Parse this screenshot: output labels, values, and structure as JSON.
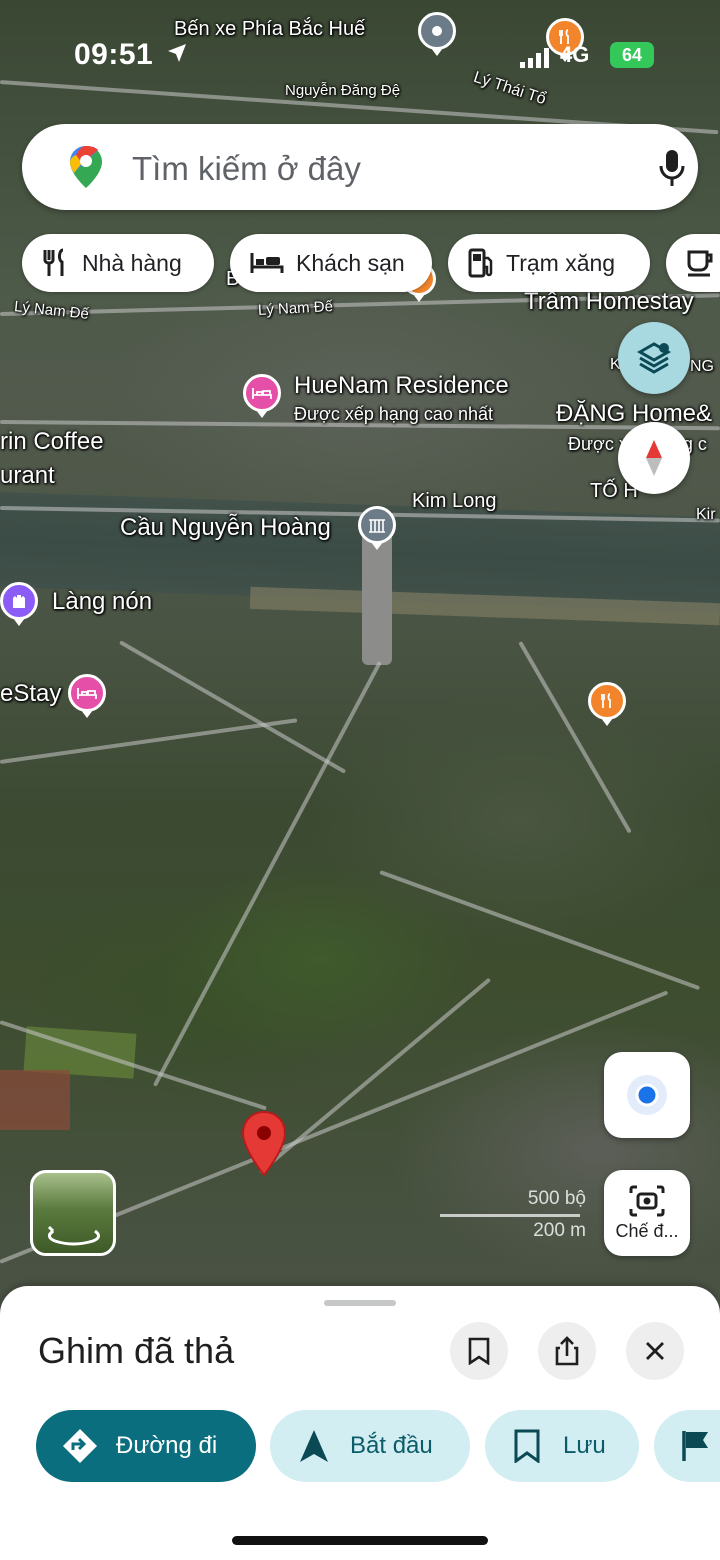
{
  "status_bar": {
    "time": "09:51",
    "network": "4G",
    "battery": "64"
  },
  "map": {
    "labels": {
      "bus_station": "Bến xe Phía Bắc Huế",
      "street_nguyen_dang_de": "Nguyễn Đăng Đệ",
      "street_ly_thai_to": "Lý Thái Tổ",
      "street_ly_nam_de_1": "Lý Nam Đế",
      "street_ly_nam_de_2": "Lý Nam Đế",
      "tram_homestay": "Trâm Homestay",
      "huenam_name": "HueNam Residence",
      "huenam_sub": "Được xếp hạng cao nhất",
      "dang_home": "ĐẶNG Home&",
      "dang_home_sub": "Được xếp hạng c",
      "kng": "K",
      "ng": "NG",
      "coffee": "rin Coffee",
      "urant": "urant",
      "kim_long": "Kim Long",
      "kim_edge": "Kir",
      "to_h": "TỐ H",
      "bridge": "Cầu Nguyễn Hoàng",
      "lang_non": "Làng nón",
      "estay": "eStay",
      "b_partial": "B"
    },
    "scale": {
      "imperial": "500 bộ",
      "metric": "200 m"
    },
    "camera_label": "Chế đ..."
  },
  "search": {
    "placeholder": "Tìm kiếm ở đây"
  },
  "chips": [
    {
      "label": "Nhà hàng",
      "icon": "restaurant-icon"
    },
    {
      "label": "Khách sạn",
      "icon": "hotel-icon"
    },
    {
      "label": "Trạm xăng",
      "icon": "gas-station-icon"
    },
    {
      "label": "",
      "icon": "coffee-icon"
    }
  ],
  "sheet": {
    "title": "Ghim đã thả",
    "actions": {
      "directions": "Đường đi",
      "start": "Bắt đầu",
      "save": "Lưu"
    }
  },
  "colors": {
    "primary": "#0b6e7e",
    "secondary_bg": "#d3eef3",
    "pin_red": "#e53935",
    "poi_pink": "#e64fa8",
    "poi_orange": "#f2852b"
  }
}
